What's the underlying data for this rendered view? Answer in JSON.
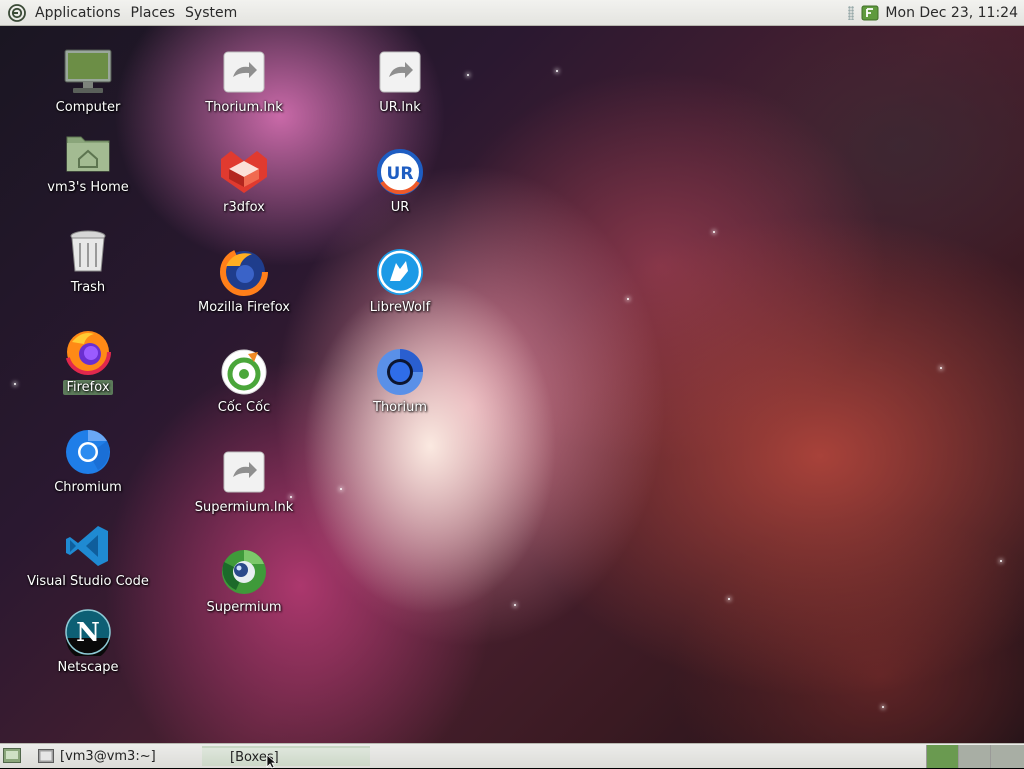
{
  "top_panel": {
    "menus": [
      "Applications",
      "Places",
      "System"
    ],
    "clock": "Mon Dec 23, 11:24"
  },
  "desktop_icons": [
    {
      "label": "Computer",
      "icon": "computer-icon"
    },
    {
      "label": "vm3's Home",
      "icon": "home-folder-icon"
    },
    {
      "label": "Trash",
      "icon": "trash-icon"
    },
    {
      "label": "Firefox",
      "icon": "firefox-icon",
      "selected": true
    },
    {
      "label": "Chromium",
      "icon": "chromium-icon"
    },
    {
      "label": "Visual Studio Code",
      "icon": "vscode-icon"
    },
    {
      "label": "Netscape",
      "icon": "netscape-icon"
    },
    {
      "label": "Thorium.lnk",
      "icon": "shortcut-icon"
    },
    {
      "label": "r3dfox",
      "icon": "r3dfox-icon"
    },
    {
      "label": "Mozilla Firefox",
      "icon": "firefox-icon"
    },
    {
      "label": "Cốc Cốc",
      "icon": "coccoc-icon"
    },
    {
      "label": "Supermium.lnk",
      "icon": "shortcut-icon"
    },
    {
      "label": "Supermium",
      "icon": "supermium-icon"
    },
    {
      "label": "UR.lnk",
      "icon": "shortcut-icon"
    },
    {
      "label": "UR",
      "icon": "ur-browser-icon"
    },
    {
      "label": "LibreWolf",
      "icon": "librewolf-icon"
    },
    {
      "label": "Thorium",
      "icon": "thorium-icon"
    }
  ],
  "taskbar": {
    "tasks": [
      {
        "label": "[vm3@vm3:~]",
        "icon": "terminal-icon"
      },
      {
        "label": "[Boxes]",
        "active": true
      }
    ],
    "workspaces": 4
  },
  "colors": {
    "panel_bg": "#e8e8e4",
    "selection": "#5c7a5a",
    "workspace_active": "#6a9a50",
    "workspace_inactive": "#a8aea4"
  }
}
